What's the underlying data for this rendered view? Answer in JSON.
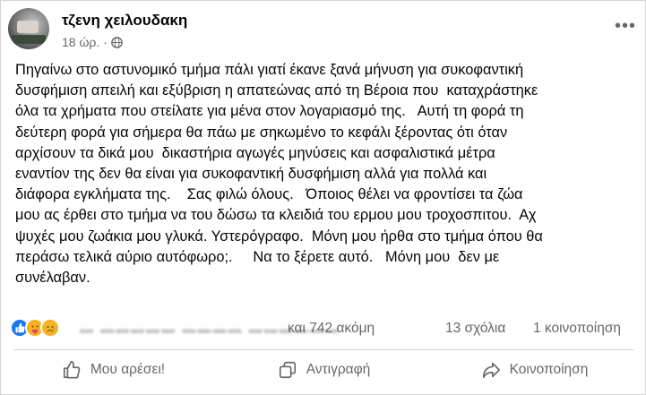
{
  "post": {
    "author": "τζενη χειλουδακη",
    "time": "18 ώρ. ·",
    "more_icon": "more-horizontal-icon",
    "privacy_icon": "globe-icon",
    "text": "Πηγαίνω στο αστυνομικό τμήμα πάλι γιατί έκανε ξανά μήνυση για συκοφαντική\nδυσφήμιση απειλή και εξύβριση η απατεώνας από τη Βέροια που  καταχράστηκε\nόλα τα χρήματα που στείλατε για μένα στον λογαριασμό της.   Αυτή τη φορά τη\nδεύτερη φορά για σήμερα θα πάω με σηκωμένο το κεφάλι ξέροντας ότι όταν\nαρχίσουν τα δικά μου  δικαστήρια αγωγές μηνύσεις και ασφαλιστικά μέτρα\nεναντίον της δεν θα είναι για συκοφαντική δυσφήμιση αλλά για πολλά και\nδιάφορα εγκλήματα της.    Σας φιλώ όλους.   Όποιος θέλει να φροντίσει τα ζώα\nμου ας έρθει στο τμήμα να του δώσω τα κλειδιά του ερμου μου τροχοσπιτου.  Αχ\nψυχές μου ζωάκια μου γλυκά. Υστερόγραφο.  Μόνη μου ήρθα στο τμήμα όπου θα\nπεράσω τελικά αύριο αυτόφωρο;.     Να το ξέρετε αυτό.   Μόνη μου  δεν με\nσυνέλαβαν."
  },
  "stats": {
    "reaction_icons": [
      "like-reaction-icon",
      "care-reaction-icon",
      "sad-reaction-icon"
    ],
    "others_label": "και 742 ακόμη",
    "comments_label": "13 σχόλια",
    "shares_label": "1 κοινοποίηση"
  },
  "actions": {
    "like_label": "Μου αρέσει!",
    "copy_label": "Αντιγραφή",
    "share_label": "Κοινοποίηση"
  },
  "colors": {
    "like_blue": "#1877f2",
    "reaction_yellow": "#f7b125",
    "secondary_text": "#65676b",
    "divider": "#ced0d4"
  }
}
